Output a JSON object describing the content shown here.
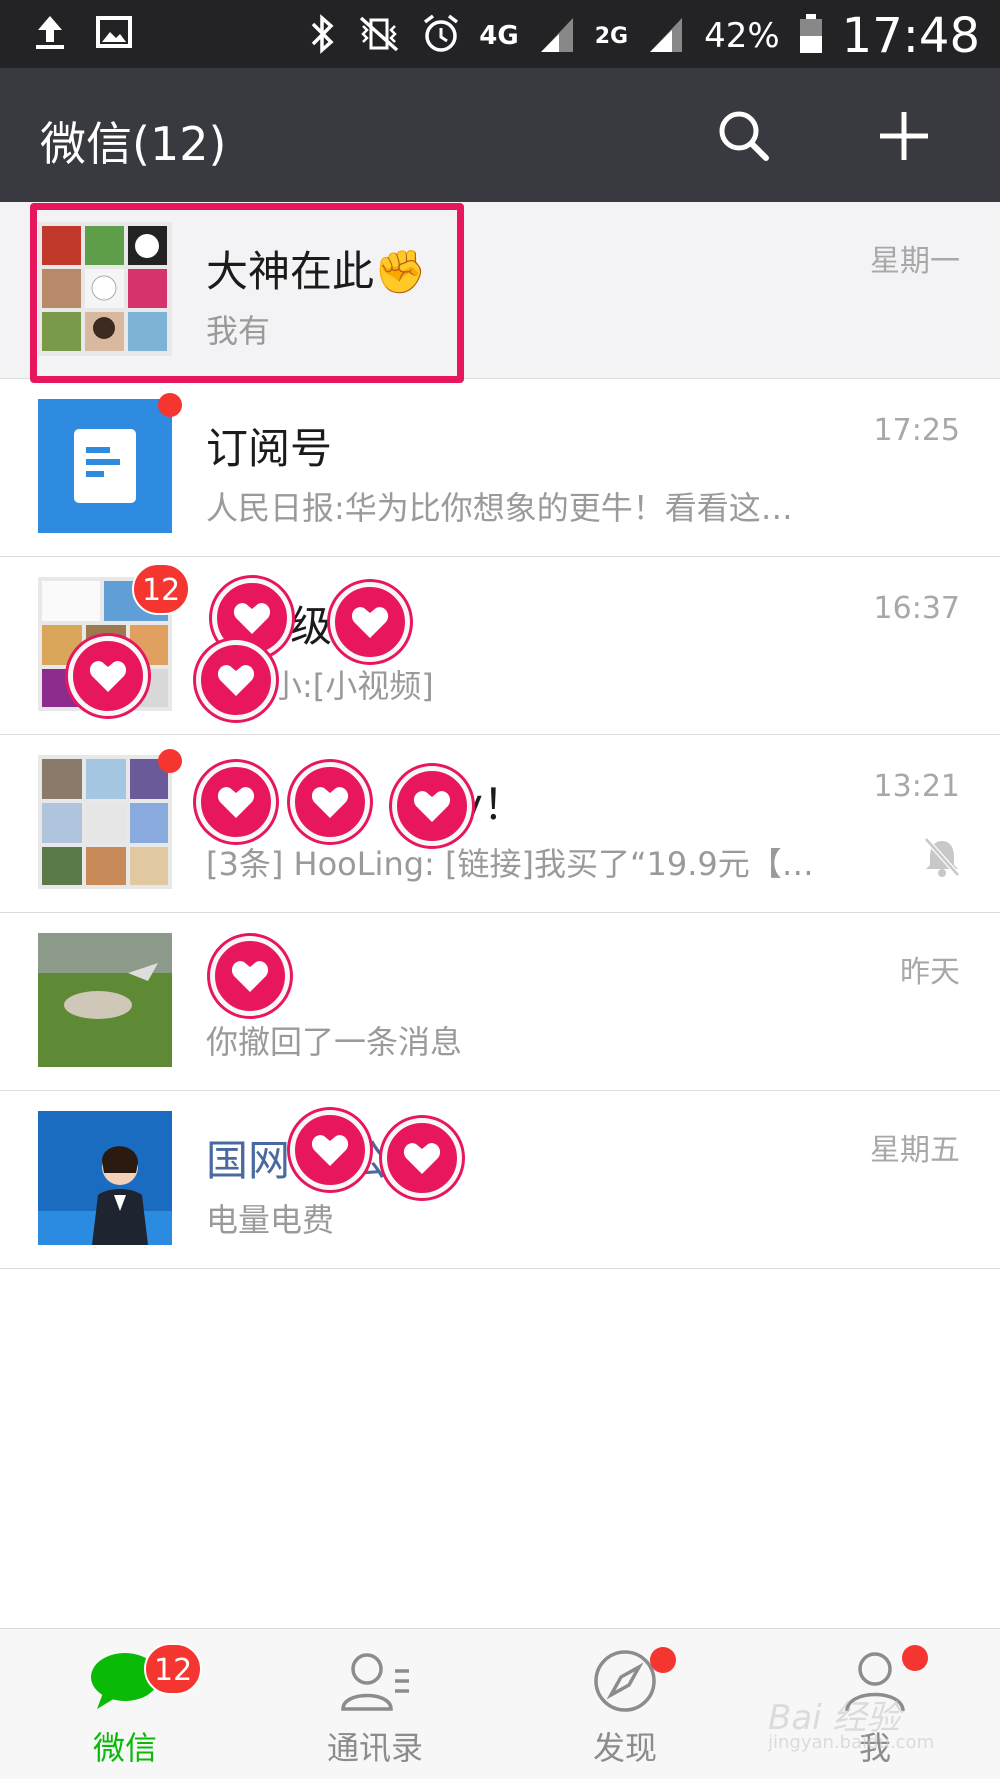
{
  "status_bar": {
    "battery_percent": "42%",
    "time": "17:48",
    "network_1": "4G",
    "network_2": "4G",
    "network_3": "2G"
  },
  "header": {
    "title": "微信(12)",
    "search_icon": "search-icon",
    "add_icon": "plus-icon"
  },
  "chats": [
    {
      "name": "大神在此✊",
      "preview": "我有",
      "time": "星期一",
      "pinned": true
    },
    {
      "name": "订阅号",
      "preview": "人民日报:华为比你想象的更牛！看看这…",
      "time": "17:25",
      "dot": true
    },
    {
      "name": "级",
      "preview": "小:[小视频]",
      "time": "16:37",
      "badge": "12"
    },
    {
      "name": "y！",
      "preview": "[3条] HooLing: [链接]我买了“19.9元【…",
      "time": "13:21",
      "dot": true,
      "muted": true
    },
    {
      "name": "",
      "preview": "你撤回了一条消息",
      "time": "昨天"
    },
    {
      "name": "国网 力公司",
      "preview": "电量电费",
      "time": "星期五"
    }
  ],
  "tabs": [
    {
      "label": "微信",
      "icon": "chat-bubble-icon",
      "badge": "12",
      "active": true
    },
    {
      "label": "通讯录",
      "icon": "contacts-icon"
    },
    {
      "label": "发现",
      "icon": "compass-icon",
      "dot": true
    },
    {
      "label": "我",
      "icon": "person-icon",
      "dot": true
    }
  ],
  "watermark": {
    "text": "Bai 经验",
    "sub": "jingyan.baidu.com"
  },
  "colors": {
    "status_bar_bg": "#232326",
    "title_bar_bg": "#393a3f",
    "accent_green": "#09bb07",
    "badge_red": "#f43530",
    "highlight_pink": "#e8175d"
  }
}
